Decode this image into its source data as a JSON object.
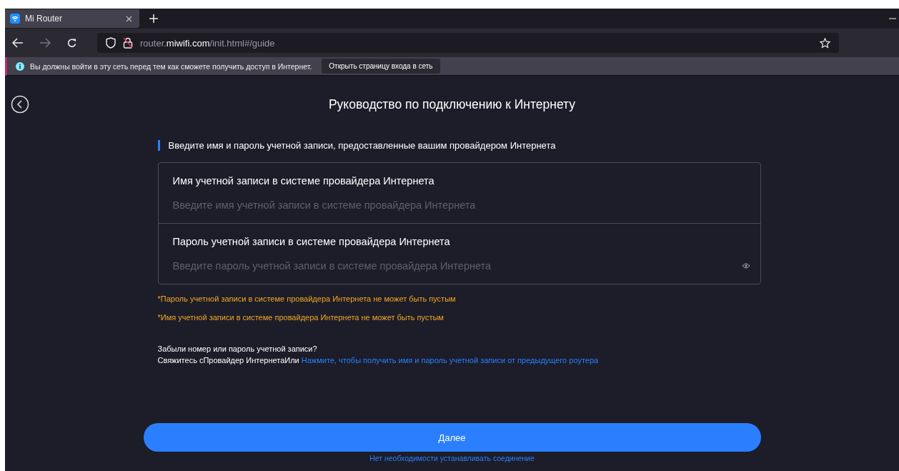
{
  "browser": {
    "tab": {
      "title": "Mi Router",
      "selected": true
    },
    "url": "router.**miwifi.com**/init.html#/guide"
  },
  "notification": {
    "message": "Вы должны войти в эту сеть перед тем как сможете получить доступ в Интернет.",
    "button": "Открыть страницу входа в сеть"
  },
  "page": {
    "title": "Руководство по подключению к Интернету",
    "section_heading": "Введите имя и пароль учетной записи, предоставленные вашим провайдером Интернета",
    "fields": [
      {
        "kind": "text",
        "label": "Имя учетной записи в системе провайдера Интернета",
        "placeholder": "Введите имя учетной записи в системе провайдера Интернета"
      },
      {
        "kind": "password",
        "label": "Пароль учетной записи в системе провайдера Интернета",
        "placeholder": "Введите пароль учетной записи в системе провайдера Интернета"
      }
    ],
    "errors": [
      "*Пароль учетной записи в системе провайдера Интернета не может быть пустым",
      "*Имя учетной записи в системе провайдера Интернета не может быть пустым"
    ],
    "help_question": "Забыли номер или пароль учетной записи?",
    "help_text": "Свяжитесь сПровайдер ИнтернетаИли",
    "help_link": "Нажмите, чтобы получить имя и пароль учетной записи от предыдущего роутера",
    "next_button": "Далее",
    "skip_link": "Нет необходимости устанавливать соединение"
  }
}
